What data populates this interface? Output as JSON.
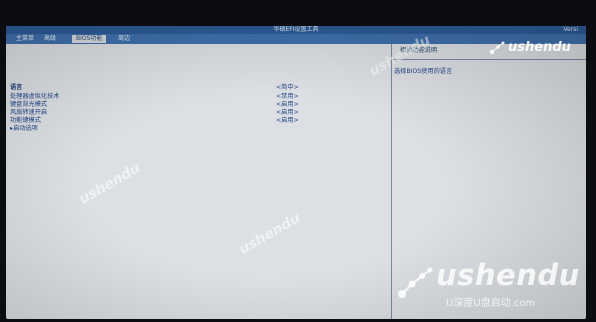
{
  "bios": {
    "title": "华硕EFI设置工具",
    "version": "Versi",
    "tabs": [
      {
        "label": "主菜单",
        "active": false
      },
      {
        "label": "高级",
        "active": false
      },
      {
        "label": "BIOS功能",
        "active": true
      },
      {
        "label": "周边",
        "active": false
      }
    ],
    "settings": [
      {
        "label": "语言",
        "value": "<简中>",
        "strong": true
      },
      {
        "label": "处理器虚拟化技术",
        "value": "<禁用>"
      },
      {
        "label": "键盘背光模式",
        "value": "<启用>"
      },
      {
        "label": "风扇转速开启",
        "value": "<启用>"
      },
      {
        "label": "功能键模式",
        "value": "<启用>"
      },
      {
        "label": "▸启动选项",
        "value": ""
      }
    ],
    "help": {
      "heading": "相关功能说明",
      "text": "选择BIOS使用的语言"
    }
  },
  "watermark": {
    "brand": "ushendu",
    "tagline": "U深度U盘启动.com"
  },
  "colors": {
    "titlebar": "#2c5c98",
    "tabbar": "#3f70ad",
    "panel_bg": "#dcdfe3",
    "text": "#22458a"
  }
}
